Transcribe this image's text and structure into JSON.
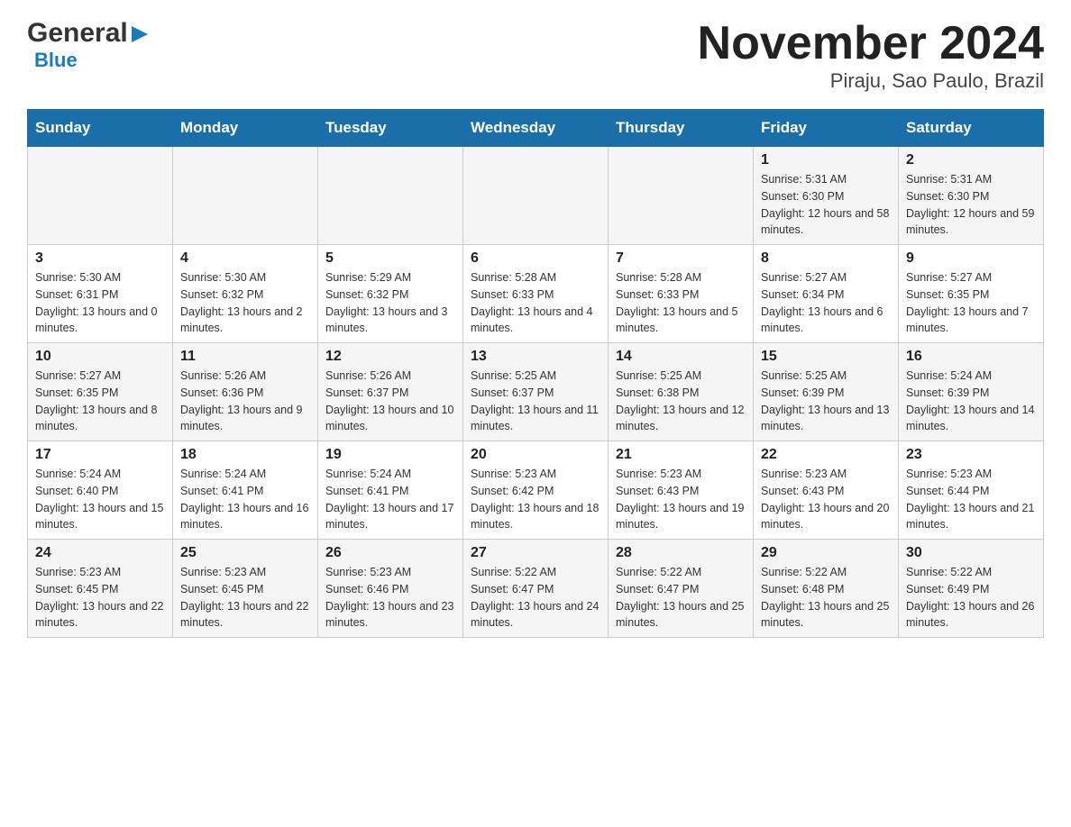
{
  "logo": {
    "general": "General",
    "arrow": "▶",
    "blue": "Blue"
  },
  "title": "November 2024",
  "subtitle": "Piraju, Sao Paulo, Brazil",
  "weekdays": [
    "Sunday",
    "Monday",
    "Tuesday",
    "Wednesday",
    "Thursday",
    "Friday",
    "Saturday"
  ],
  "weeks": [
    [
      {
        "day": "",
        "sunrise": "",
        "sunset": "",
        "daylight": ""
      },
      {
        "day": "",
        "sunrise": "",
        "sunset": "",
        "daylight": ""
      },
      {
        "day": "",
        "sunrise": "",
        "sunset": "",
        "daylight": ""
      },
      {
        "day": "",
        "sunrise": "",
        "sunset": "",
        "daylight": ""
      },
      {
        "day": "",
        "sunrise": "",
        "sunset": "",
        "daylight": ""
      },
      {
        "day": "1",
        "sunrise": "Sunrise: 5:31 AM",
        "sunset": "Sunset: 6:30 PM",
        "daylight": "Daylight: 12 hours and 58 minutes."
      },
      {
        "day": "2",
        "sunrise": "Sunrise: 5:31 AM",
        "sunset": "Sunset: 6:30 PM",
        "daylight": "Daylight: 12 hours and 59 minutes."
      }
    ],
    [
      {
        "day": "3",
        "sunrise": "Sunrise: 5:30 AM",
        "sunset": "Sunset: 6:31 PM",
        "daylight": "Daylight: 13 hours and 0 minutes."
      },
      {
        "day": "4",
        "sunrise": "Sunrise: 5:30 AM",
        "sunset": "Sunset: 6:32 PM",
        "daylight": "Daylight: 13 hours and 2 minutes."
      },
      {
        "day": "5",
        "sunrise": "Sunrise: 5:29 AM",
        "sunset": "Sunset: 6:32 PM",
        "daylight": "Daylight: 13 hours and 3 minutes."
      },
      {
        "day": "6",
        "sunrise": "Sunrise: 5:28 AM",
        "sunset": "Sunset: 6:33 PM",
        "daylight": "Daylight: 13 hours and 4 minutes."
      },
      {
        "day": "7",
        "sunrise": "Sunrise: 5:28 AM",
        "sunset": "Sunset: 6:33 PM",
        "daylight": "Daylight: 13 hours and 5 minutes."
      },
      {
        "day": "8",
        "sunrise": "Sunrise: 5:27 AM",
        "sunset": "Sunset: 6:34 PM",
        "daylight": "Daylight: 13 hours and 6 minutes."
      },
      {
        "day": "9",
        "sunrise": "Sunrise: 5:27 AM",
        "sunset": "Sunset: 6:35 PM",
        "daylight": "Daylight: 13 hours and 7 minutes."
      }
    ],
    [
      {
        "day": "10",
        "sunrise": "Sunrise: 5:27 AM",
        "sunset": "Sunset: 6:35 PM",
        "daylight": "Daylight: 13 hours and 8 minutes."
      },
      {
        "day": "11",
        "sunrise": "Sunrise: 5:26 AM",
        "sunset": "Sunset: 6:36 PM",
        "daylight": "Daylight: 13 hours and 9 minutes."
      },
      {
        "day": "12",
        "sunrise": "Sunrise: 5:26 AM",
        "sunset": "Sunset: 6:37 PM",
        "daylight": "Daylight: 13 hours and 10 minutes."
      },
      {
        "day": "13",
        "sunrise": "Sunrise: 5:25 AM",
        "sunset": "Sunset: 6:37 PM",
        "daylight": "Daylight: 13 hours and 11 minutes."
      },
      {
        "day": "14",
        "sunrise": "Sunrise: 5:25 AM",
        "sunset": "Sunset: 6:38 PM",
        "daylight": "Daylight: 13 hours and 12 minutes."
      },
      {
        "day": "15",
        "sunrise": "Sunrise: 5:25 AM",
        "sunset": "Sunset: 6:39 PM",
        "daylight": "Daylight: 13 hours and 13 minutes."
      },
      {
        "day": "16",
        "sunrise": "Sunrise: 5:24 AM",
        "sunset": "Sunset: 6:39 PM",
        "daylight": "Daylight: 13 hours and 14 minutes."
      }
    ],
    [
      {
        "day": "17",
        "sunrise": "Sunrise: 5:24 AM",
        "sunset": "Sunset: 6:40 PM",
        "daylight": "Daylight: 13 hours and 15 minutes."
      },
      {
        "day": "18",
        "sunrise": "Sunrise: 5:24 AM",
        "sunset": "Sunset: 6:41 PM",
        "daylight": "Daylight: 13 hours and 16 minutes."
      },
      {
        "day": "19",
        "sunrise": "Sunrise: 5:24 AM",
        "sunset": "Sunset: 6:41 PM",
        "daylight": "Daylight: 13 hours and 17 minutes."
      },
      {
        "day": "20",
        "sunrise": "Sunrise: 5:23 AM",
        "sunset": "Sunset: 6:42 PM",
        "daylight": "Daylight: 13 hours and 18 minutes."
      },
      {
        "day": "21",
        "sunrise": "Sunrise: 5:23 AM",
        "sunset": "Sunset: 6:43 PM",
        "daylight": "Daylight: 13 hours and 19 minutes."
      },
      {
        "day": "22",
        "sunrise": "Sunrise: 5:23 AM",
        "sunset": "Sunset: 6:43 PM",
        "daylight": "Daylight: 13 hours and 20 minutes."
      },
      {
        "day": "23",
        "sunrise": "Sunrise: 5:23 AM",
        "sunset": "Sunset: 6:44 PM",
        "daylight": "Daylight: 13 hours and 21 minutes."
      }
    ],
    [
      {
        "day": "24",
        "sunrise": "Sunrise: 5:23 AM",
        "sunset": "Sunset: 6:45 PM",
        "daylight": "Daylight: 13 hours and 22 minutes."
      },
      {
        "day": "25",
        "sunrise": "Sunrise: 5:23 AM",
        "sunset": "Sunset: 6:45 PM",
        "daylight": "Daylight: 13 hours and 22 minutes."
      },
      {
        "day": "26",
        "sunrise": "Sunrise: 5:23 AM",
        "sunset": "Sunset: 6:46 PM",
        "daylight": "Daylight: 13 hours and 23 minutes."
      },
      {
        "day": "27",
        "sunrise": "Sunrise: 5:22 AM",
        "sunset": "Sunset: 6:47 PM",
        "daylight": "Daylight: 13 hours and 24 minutes."
      },
      {
        "day": "28",
        "sunrise": "Sunrise: 5:22 AM",
        "sunset": "Sunset: 6:47 PM",
        "daylight": "Daylight: 13 hours and 25 minutes."
      },
      {
        "day": "29",
        "sunrise": "Sunrise: 5:22 AM",
        "sunset": "Sunset: 6:48 PM",
        "daylight": "Daylight: 13 hours and 25 minutes."
      },
      {
        "day": "30",
        "sunrise": "Sunrise: 5:22 AM",
        "sunset": "Sunset: 6:49 PM",
        "daylight": "Daylight: 13 hours and 26 minutes."
      }
    ]
  ]
}
